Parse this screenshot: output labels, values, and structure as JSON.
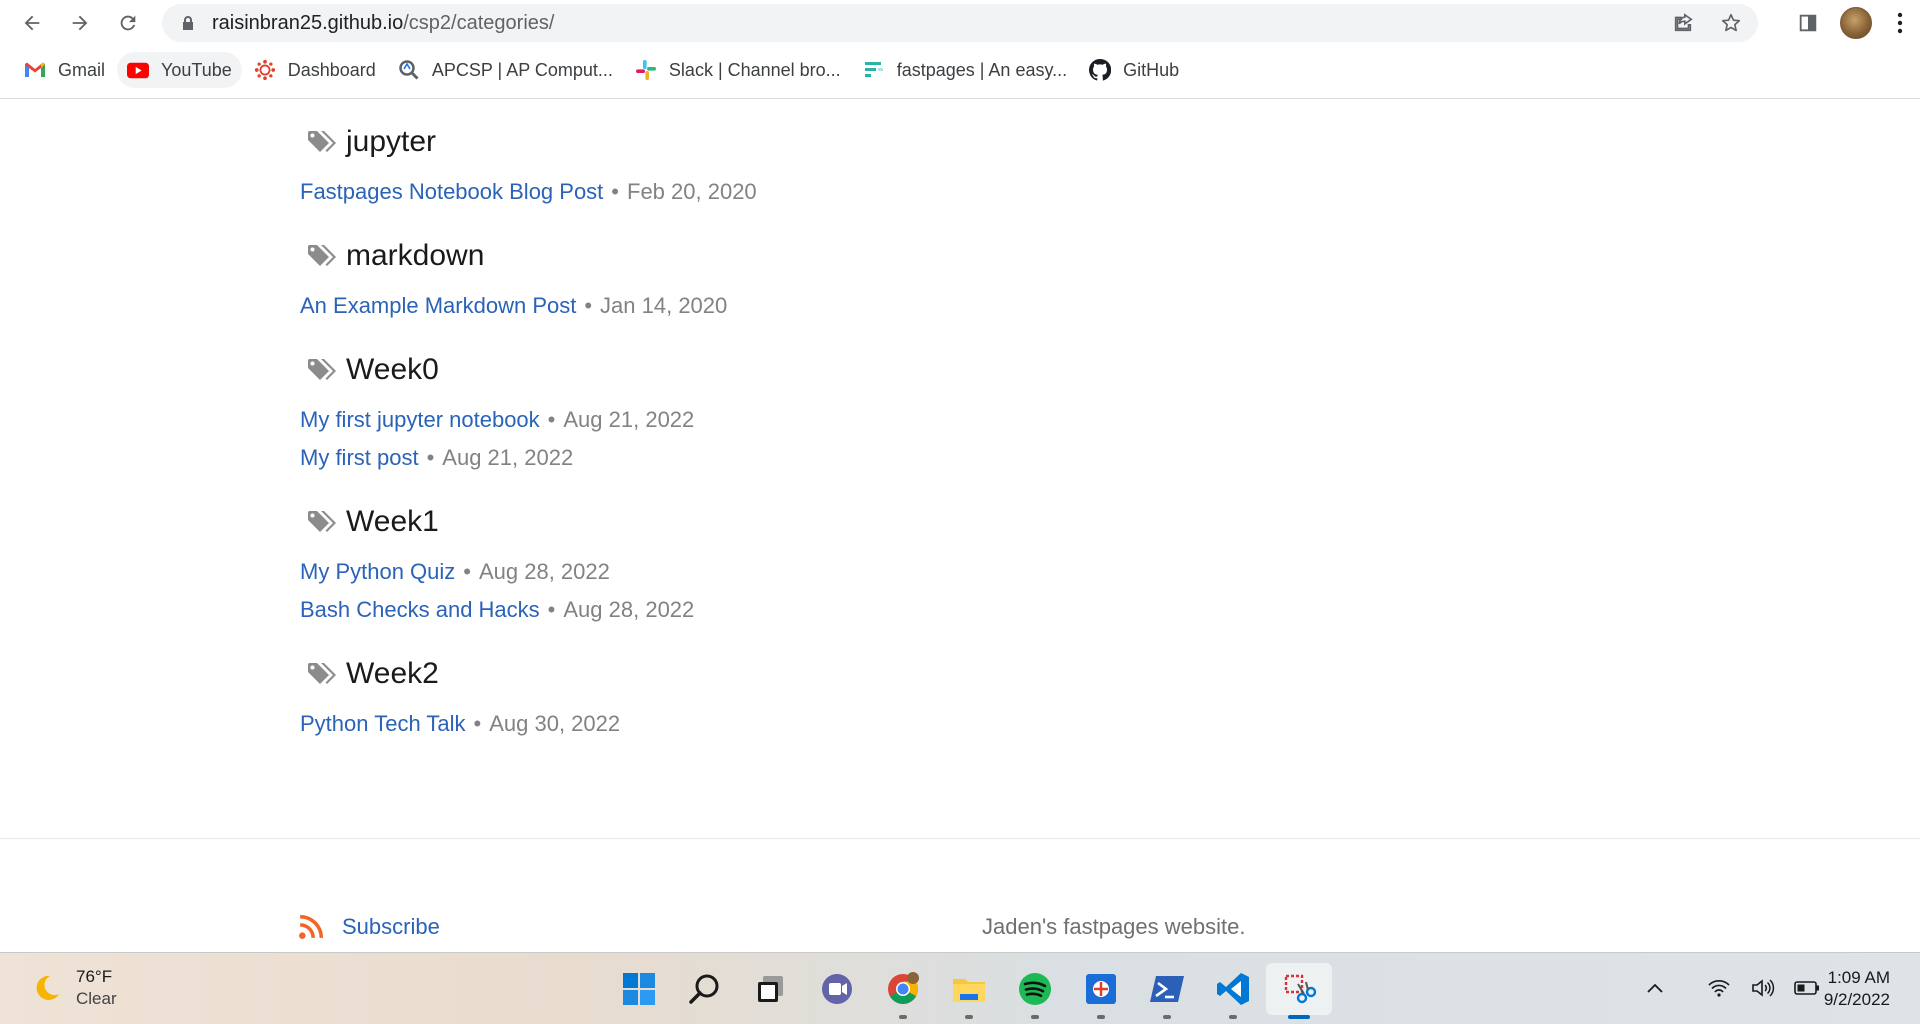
{
  "browser": {
    "url_host": "raisinbran25.github.io",
    "url_path": "/csp2/categories/",
    "bookmarks": [
      {
        "label": "Gmail",
        "icon": "gmail-icon"
      },
      {
        "label": "YouTube",
        "icon": "youtube-icon"
      },
      {
        "label": "Dashboard",
        "icon": "canvas-icon"
      },
      {
        "label": "APCSP | AP Comput...",
        "icon": "apcsp-icon"
      },
      {
        "label": "Slack | Channel bro...",
        "icon": "slack-icon"
      },
      {
        "label": "fastpages | An easy...",
        "icon": "fastpages-icon"
      },
      {
        "label": "GitHub",
        "icon": "github-icon"
      }
    ]
  },
  "categories": [
    {
      "name": "jupyter",
      "posts": [
        {
          "title": "Fastpages Notebook Blog Post",
          "date": "Feb 20, 2020"
        }
      ]
    },
    {
      "name": "markdown",
      "posts": [
        {
          "title": "An Example Markdown Post",
          "date": "Jan 14, 2020"
        }
      ]
    },
    {
      "name": "Week0",
      "posts": [
        {
          "title": "My first jupyter notebook",
          "date": "Aug 21, 2022"
        },
        {
          "title": "My first post",
          "date": "Aug 21, 2022"
        }
      ]
    },
    {
      "name": "Week1",
      "posts": [
        {
          "title": "My Python Quiz",
          "date": "Aug 28, 2022"
        },
        {
          "title": "Bash Checks and Hacks",
          "date": "Aug 28, 2022"
        }
      ]
    },
    {
      "name": "Week2",
      "posts": [
        {
          "title": "Python Tech Talk",
          "date": "Aug 30, 2022"
        }
      ]
    }
  ],
  "separator": "•",
  "footer": {
    "subscribe_label": "Subscribe",
    "site_description": "Jaden's fastpages website."
  },
  "taskbar": {
    "temperature": "76°F",
    "condition": "Clear",
    "time": "1:09 AM",
    "date": "9/2/2022"
  },
  "colors": {
    "link": "#2a63b8",
    "meta": "#828282",
    "accent": "#0067c0"
  }
}
